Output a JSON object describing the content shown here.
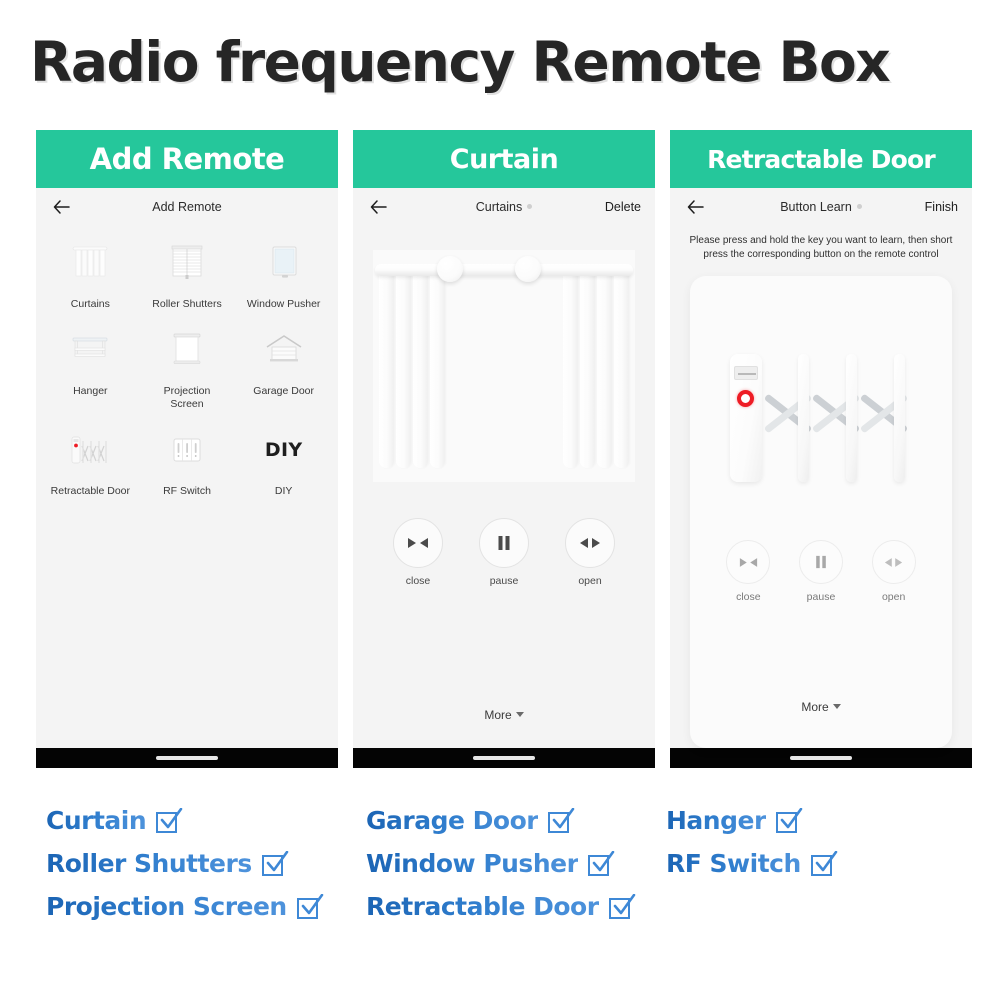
{
  "title": "Radio frequency Remote Box",
  "colors": {
    "banner_green": "#25c79b",
    "feature_blue_dark": "#1b64b4",
    "feature_blue_light": "#4e93dc",
    "led_red": "#ee1c25",
    "screen_bg": "#f4f4f4"
  },
  "panels": [
    {
      "banner": "Add Remote",
      "nav": {
        "back_icon": "arrow-left-icon",
        "title": "Add Remote",
        "action": ""
      },
      "grid": [
        {
          "label": "Curtains",
          "icon": "curtains-icon"
        },
        {
          "label": "Roller Shutters",
          "icon": "roller-shutters-icon"
        },
        {
          "label": "Window Pusher",
          "icon": "window-pusher-icon"
        },
        {
          "label": "Hanger",
          "icon": "hanger-icon"
        },
        {
          "label": "Projection Screen",
          "icon": "projection-screen-icon"
        },
        {
          "label": "Garage Door",
          "icon": "garage-door-icon"
        },
        {
          "label": "Retractable Door",
          "icon": "retractable-door-icon"
        },
        {
          "label": "RF Switch",
          "icon": "rf-switch-icon"
        },
        {
          "label": "DIY",
          "icon": "diy-text-icon",
          "text": "DIY"
        }
      ]
    },
    {
      "banner": "Curtain",
      "nav": {
        "back_icon": "arrow-left-icon",
        "title": "Curtains",
        "action": "Delete",
        "has_dot": true
      },
      "controls": [
        {
          "label": "close",
          "icon": "close-curtain-icon"
        },
        {
          "label": "pause",
          "icon": "pause-icon"
        },
        {
          "label": "open",
          "icon": "open-curtain-icon"
        }
      ],
      "more": "More"
    },
    {
      "banner": "Retractable Door",
      "nav": {
        "back_icon": "arrow-left-icon",
        "title": "Button Learn",
        "action": "Finish",
        "has_dot": true
      },
      "hint": "Please press and hold the key you want to learn, then short press the corresponding button on the remote control",
      "controls": [
        {
          "label": "close",
          "icon": "close-curtain-icon"
        },
        {
          "label": "pause",
          "icon": "pause-icon"
        },
        {
          "label": "open",
          "icon": "open-curtain-icon"
        }
      ],
      "more": "More"
    }
  ],
  "features": [
    {
      "label": "Curtain",
      "checked": true
    },
    {
      "label": "Garage Door",
      "checked": true
    },
    {
      "label": "Hanger",
      "checked": true
    },
    {
      "label": "Roller Shutters",
      "checked": true
    },
    {
      "label": "Window Pusher",
      "checked": true
    },
    {
      "label": "RF Switch",
      "checked": true
    },
    {
      "label": "Projection Screen",
      "checked": true
    },
    {
      "label": "Retractable Door",
      "checked": true
    }
  ]
}
